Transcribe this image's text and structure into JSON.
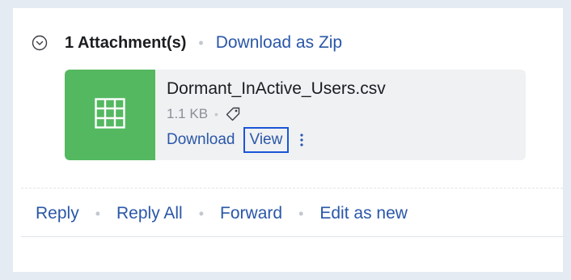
{
  "attachments": {
    "count_label": "1 Attachment(s)",
    "download_zip_label": "Download as Zip",
    "collapse_icon": "chevron-circle-icon"
  },
  "file": {
    "name": "Dormant_InActive_Users.csv",
    "size": "1.1 KB",
    "type_icon": "spreadsheet-grid-icon",
    "thumb_color": "#54b860",
    "download_label": "Download",
    "view_label": "View"
  },
  "actions": {
    "reply_label": "Reply",
    "reply_all_label": "Reply All",
    "forward_label": "Forward",
    "edit_as_new_label": "Edit as new"
  },
  "colors": {
    "link": "#2a57a8",
    "focus_border": "#1a56d6",
    "background": "#e4ebf3"
  }
}
